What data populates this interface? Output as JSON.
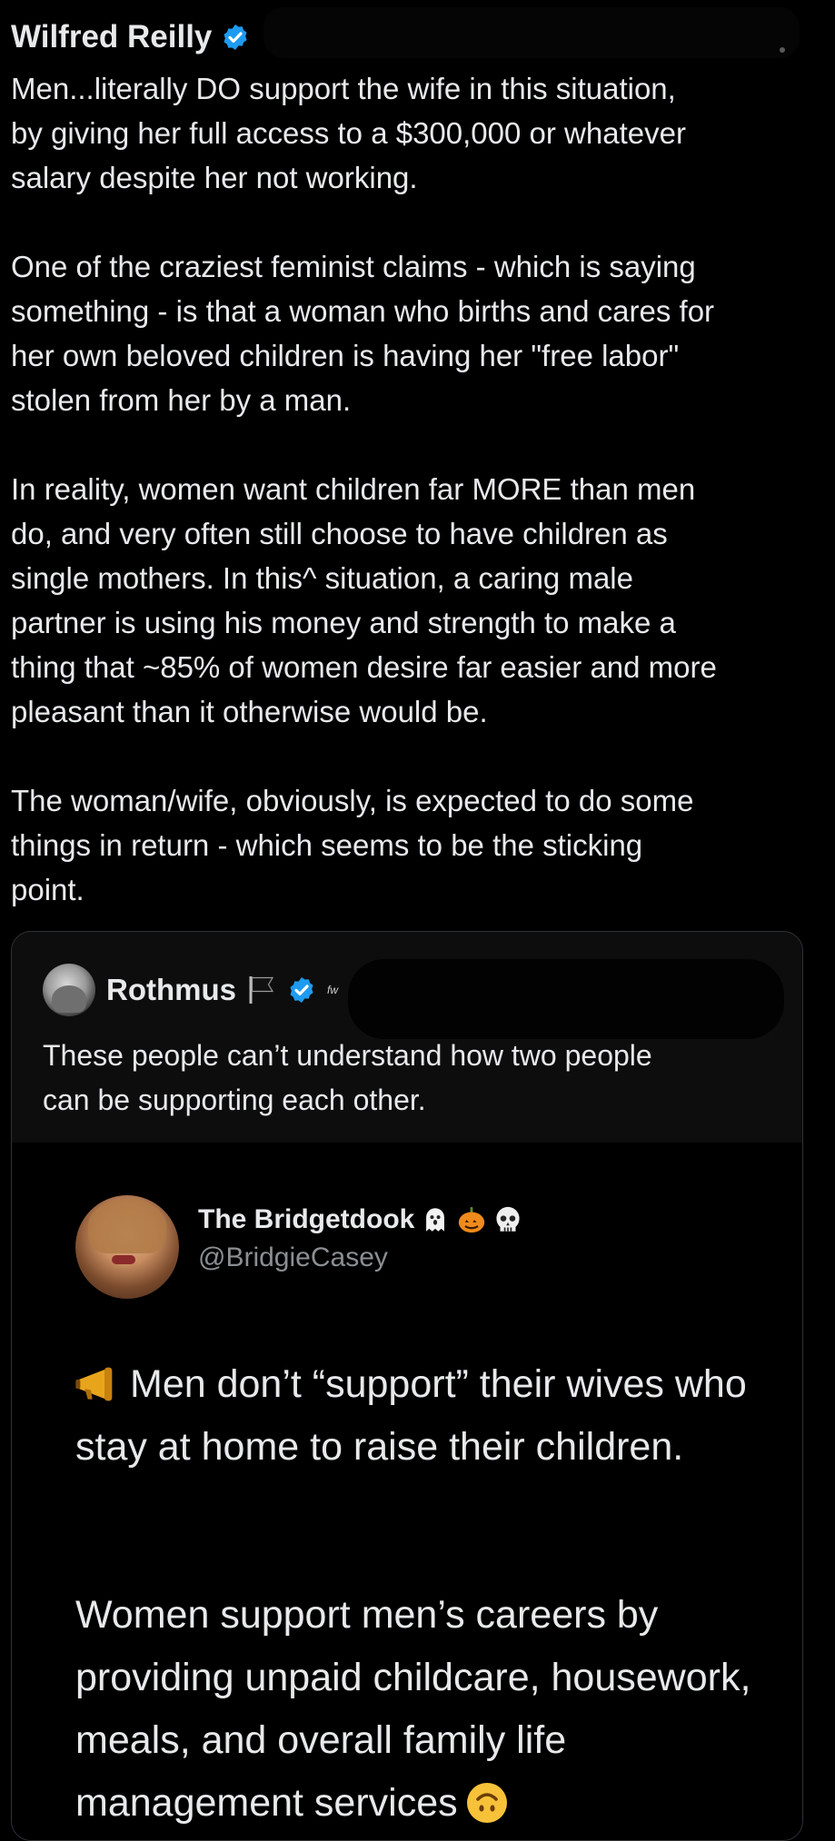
{
  "post": {
    "author_name": "Wilfred Reilly",
    "verified_icon": "verified-badge-icon",
    "paragraphs": [
      "Men...literally DO support the wife in this situation,\nby giving her full access to a $300,000 or whatever\nsalary despite her not working.",
      "One of the craziest feminist claims - which is saying\nsomething - is that a woman who births and cares for\nher own beloved children is having her \"free labor\"\nstolen from her by a man.",
      "In reality, women want children far MORE than men\ndo, and very often still choose to have children as\nsingle mothers. In this^ situation, a caring male\npartner is using his money and strength to make a\nthing that ~85% of women desire far easier and more\npleasant than it otherwise would be.",
      "The woman/wife, obviously, is expected to do some\nthings in return - which seems to be the sticking\npoint."
    ]
  },
  "quote": {
    "author_name": "Rothmus",
    "flag_icon": "black-flag-icon",
    "tiny_mark": "fw",
    "text": "These people can’t understand how two people\ncan be supporting each other.",
    "embedded": {
      "name": "The Bridgetdook",
      "emojis": [
        "ghost-icon",
        "pumpkin-icon",
        "skull-icon"
      ],
      "handle": "@BridgieCasey",
      "paragraph1": "Men don’t “support” their wives who stay at home to raise their children.",
      "paragraph2": "Women support men’s careers by providing unpaid childcare, housework, meals, and overall family life management services"
    }
  },
  "colors": {
    "background": "#000000",
    "text": "#e7e9ea",
    "verified_blue": "#1d9bf0",
    "muted": "#8b8f93"
  }
}
